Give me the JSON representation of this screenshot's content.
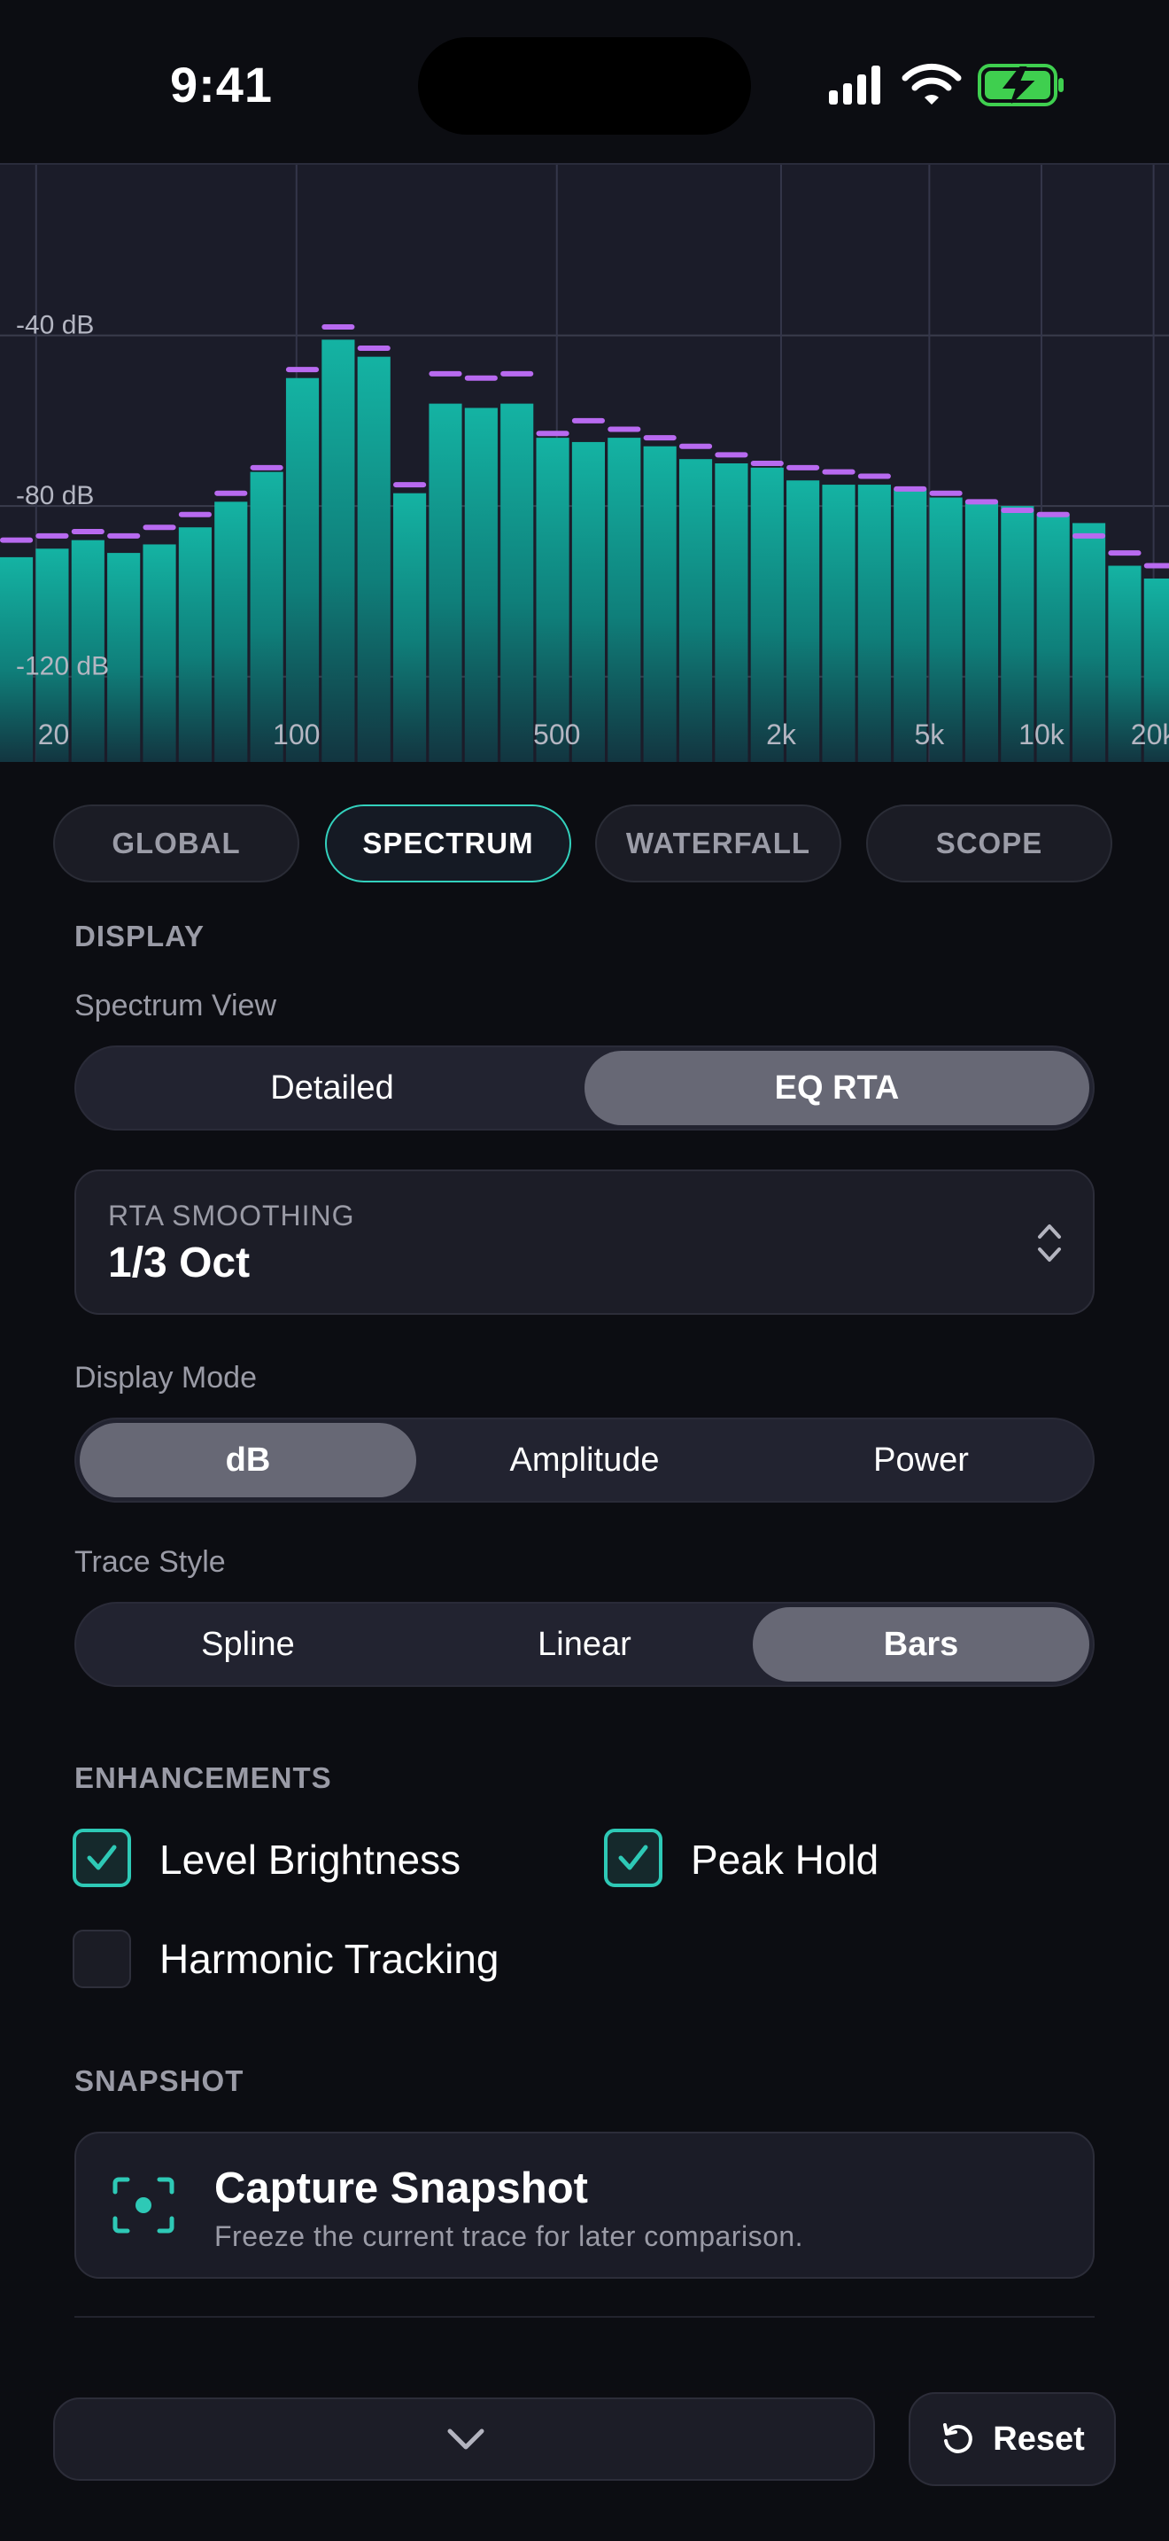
{
  "status_bar": {
    "time": "9:41"
  },
  "chart_data": {
    "type": "bar",
    "y_labels": [
      "-40 dB",
      "-80 dB",
      "-120 dB"
    ],
    "y_label_values": [
      -40,
      -80,
      -120
    ],
    "ylim": [
      -140,
      0
    ],
    "x_labels": [
      "20",
      "100",
      "500",
      "2k",
      "5k",
      "10k",
      "20k"
    ],
    "x_label_values": [
      20,
      100,
      500,
      2000,
      5000,
      10000,
      20000
    ],
    "xlim": [
      16,
      22000
    ],
    "x_scale": "log",
    "grid": true,
    "levels": [
      -92,
      -90,
      -88,
      -91,
      -89,
      -85,
      -79,
      -72,
      -50,
      -41,
      -45,
      -77,
      -56,
      -57,
      -56,
      -64,
      -65,
      -64,
      -66,
      -69,
      -70,
      -71,
      -74,
      -75,
      -75,
      -76,
      -78,
      -79,
      -80,
      -82,
      -84,
      -94,
      -97
    ],
    "peaks": [
      -88,
      -87,
      -86,
      -87,
      -85,
      -82,
      -77,
      -71,
      -48,
      -38,
      -43,
      -75,
      -49,
      -50,
      -49,
      -63,
      -60,
      -62,
      -64,
      -66,
      -68,
      -70,
      -71,
      -72,
      -73,
      -76,
      -77,
      -79,
      -81,
      -82,
      -87,
      -91,
      -94
    ],
    "bar_color": "#12a89a",
    "peak_color": "#b86af0"
  },
  "tabs": [
    {
      "label": "GLOBAL",
      "active": false
    },
    {
      "label": "SPECTRUM",
      "active": true
    },
    {
      "label": "WATERFALL",
      "active": false
    },
    {
      "label": "SCOPE",
      "active": false
    }
  ],
  "display": {
    "section_title": "DISPLAY",
    "spectrum_view": {
      "label": "Spectrum View",
      "options": [
        "Detailed",
        "EQ RTA"
      ],
      "selected": "EQ RTA"
    },
    "rta_smoothing": {
      "caption": "RTA SMOOTHING",
      "value": "1/3 Oct"
    },
    "display_mode": {
      "label": "Display Mode",
      "options": [
        "dB",
        "Amplitude",
        "Power"
      ],
      "selected": "dB"
    },
    "trace_style": {
      "label": "Trace Style",
      "options": [
        "Spline",
        "Linear",
        "Bars"
      ],
      "selected": "Bars"
    }
  },
  "enhancements": {
    "section_title": "ENHANCEMENTS",
    "level_brightness": {
      "label": "Level Brightness",
      "checked": true
    },
    "peak_hold": {
      "label": "Peak Hold",
      "checked": true
    },
    "harmonic_tracking": {
      "label": "Harmonic Tracking",
      "checked": false
    }
  },
  "snapshot": {
    "section_title": "SNAPSHOT",
    "title": "Capture Snapshot",
    "subtitle": "Freeze the current trace for later comparison."
  },
  "footer": {
    "reset_label": "Reset"
  },
  "colors": {
    "accent": "#2ec9b6",
    "peak": "#b86af0",
    "background": "#0c0d12"
  }
}
